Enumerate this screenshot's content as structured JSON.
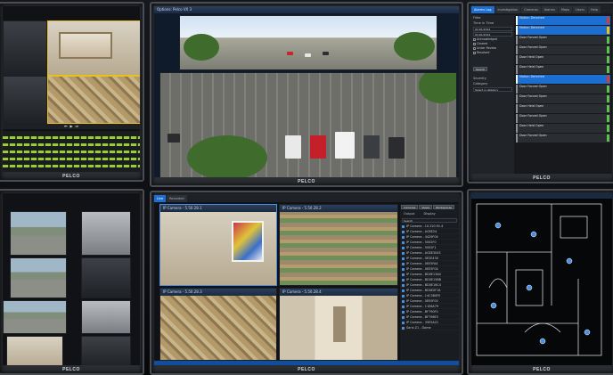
{
  "brand": "PELCO",
  "monitors": {
    "top_center": {
      "window_title": "Options: Pelco VX 3",
      "panorama_label": "PELCO"
    },
    "top_right": {
      "tabs": [
        "Alarms Log",
        "Investigation",
        "Cameras",
        "Alarms",
        "Maps",
        "Users",
        "Help"
      ],
      "filter_label": "Filter",
      "time_label": "Time in Time",
      "date_from": "01/01/2014",
      "date_to": "01/01/2014",
      "checkboxes": [
        "Acknowledged",
        "Cleared",
        "Under Review",
        "Resolved"
      ],
      "search_button": "Search",
      "severity_label": "Severity",
      "category_label": "Category",
      "category_value": "Select a category",
      "alarms": [
        {
          "title": "Motion Detected",
          "state": "active",
          "status": "red"
        },
        {
          "title": "Motion Detected",
          "state": "active",
          "status": "yel"
        },
        {
          "title": "Door Forced Open",
          "state": "normal",
          "status": "green"
        },
        {
          "title": "Door Forced Open",
          "state": "normal",
          "status": "green"
        },
        {
          "title": "Door Held Open",
          "state": "normal",
          "status": "green"
        },
        {
          "title": "Door Held Open",
          "state": "normal",
          "status": "green"
        },
        {
          "title": "Motion Detected",
          "state": "active",
          "status": "red"
        },
        {
          "title": "Door Forced Open",
          "state": "normal",
          "status": "green"
        },
        {
          "title": "Door Forced Open",
          "state": "normal",
          "status": "green"
        },
        {
          "title": "Door Held Open",
          "state": "normal",
          "status": "green"
        },
        {
          "title": "Door Forced Open",
          "state": "normal",
          "status": "green"
        },
        {
          "title": "Door Held Open",
          "state": "normal",
          "status": "green"
        },
        {
          "title": "Door Forced Open",
          "state": "normal",
          "status": "green"
        }
      ]
    },
    "bottom_center": {
      "tabs": [
        "Live",
        "Recorded"
      ],
      "camera_titles": [
        "IP Camera - 5.50.28.1",
        "IP Camera - 5.50.28.2",
        "IP Camera - 5.50.28.3",
        "IP Camera - 5.50.28.4"
      ],
      "panel_tabs": [
        "Cameras",
        "Views",
        "Workspaces"
      ],
      "output_label": "Output",
      "display_label": "Display",
      "search_placeholder": "Search",
      "camera_list": [
        "IP Camera - 10.220.91.4",
        "IP Camera - ACBE24",
        "IP Camera - 4429F04",
        "IP Camera - 5002F0",
        "IP Camera - 5002F1",
        "IP Camera - ACBE3043",
        "IP Camera - 0E2E430",
        "IP Camera - 0EE5FA4",
        "IP Camera - 0EE5F04",
        "IP Camera - BD0E13A0",
        "IP Camera - BD0E15BB",
        "IP Camera - BD0E16C4",
        "IP Camera - BD0E0F16",
        "IP Camera - 14C3B0FE",
        "IP Camera - 0EE0F00",
        "IP Camera - 11E6A79",
        "IP Camera - BF790F0",
        "IP Camera - BF796E5",
        "IP Camera - 35E5A21",
        "Sarix Z1 - Dome"
      ]
    }
  }
}
